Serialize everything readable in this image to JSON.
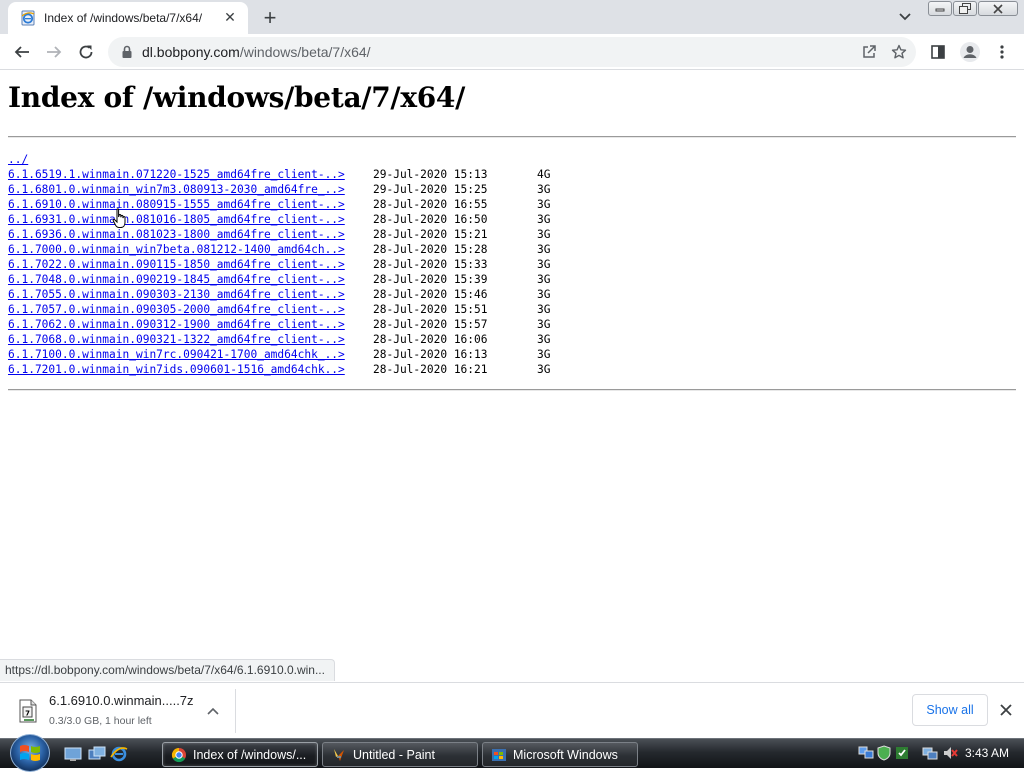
{
  "window": {
    "tab_title": "Index of /windows/beta/7/x64/",
    "tab_close": "✕",
    "new_tab": "+"
  },
  "toolbar": {
    "url_host": "dl.bobpony.com",
    "url_path": "/windows/beta/7/x64/"
  },
  "page": {
    "title": "Index of /windows/beta/7/x64/",
    "parent_link": "../",
    "entries": [
      {
        "name": "6.1.6519.1.winmain.071220-1525_amd64fre_client-..>",
        "date": "29-Jul-2020 15:13",
        "size": "4G"
      },
      {
        "name": "6.1.6801.0.winmain_win7m3.080913-2030_amd64fre_..>",
        "date": "29-Jul-2020 15:25",
        "size": "3G"
      },
      {
        "name": "6.1.6910.0.winmain.080915-1555_amd64fre_client-..>",
        "date": "28-Jul-2020 16:55",
        "size": "3G"
      },
      {
        "name": "6.1.6931.0.winmain.081016-1805_amd64fre_client-..>",
        "date": "28-Jul-2020 16:50",
        "size": "3G"
      },
      {
        "name": "6.1.6936.0.winmain.081023-1800_amd64fre_client-..>",
        "date": "28-Jul-2020 15:21",
        "size": "3G"
      },
      {
        "name": "6.1.7000.0.winmain_win7beta.081212-1400_amd64ch..>",
        "date": "28-Jul-2020 15:28",
        "size": "3G"
      },
      {
        "name": "6.1.7022.0.winmain.090115-1850_amd64fre_client-..>",
        "date": "28-Jul-2020 15:33",
        "size": "3G"
      },
      {
        "name": "6.1.7048.0.winmain.090219-1845_amd64fre_client-..>",
        "date": "28-Jul-2020 15:39",
        "size": "3G"
      },
      {
        "name": "6.1.7055.0.winmain.090303-2130_amd64fre_client-..>",
        "date": "28-Jul-2020 15:46",
        "size": "3G"
      },
      {
        "name": "6.1.7057.0.winmain.090305-2000_amd64fre_client-..>",
        "date": "28-Jul-2020 15:51",
        "size": "3G"
      },
      {
        "name": "6.1.7062.0.winmain.090312-1900_amd64fre_client-..>",
        "date": "28-Jul-2020 15:57",
        "size": "3G"
      },
      {
        "name": "6.1.7068.0.winmain.090321-1322_amd64fre_client-..>",
        "date": "28-Jul-2020 16:06",
        "size": "3G"
      },
      {
        "name": "6.1.7100.0.winmain_win7rc.090421-1700_amd64chk_..>",
        "date": "28-Jul-2020 16:13",
        "size": "3G"
      },
      {
        "name": "6.1.7201.0.winmain_win7ids.090601-1516_amd64chk..>",
        "date": "28-Jul-2020 16:21",
        "size": "3G"
      }
    ]
  },
  "status_bar": {
    "hover_url": "https://dl.bobpony.com/windows/beta/7/x64/6.1.6910.0.win..."
  },
  "downloads": {
    "file_name": "6.1.6910.0.winmain.....7z",
    "progress_text": "0.3/3.0 GB, 1 hour left",
    "progress_fraction": 0.1,
    "show_all_label": "Show all"
  },
  "taskbar": {
    "tasks": [
      {
        "label": "Index of /windows/...",
        "active": true
      },
      {
        "label": "Untitled - Paint",
        "active": false
      },
      {
        "label": "Microsoft Windows",
        "active": false
      }
    ],
    "clock": "3:43 AM"
  },
  "colors": {
    "link": "#0000ee",
    "accent": "#1a73e8",
    "tabstrip_bg": "#dee1e6"
  }
}
